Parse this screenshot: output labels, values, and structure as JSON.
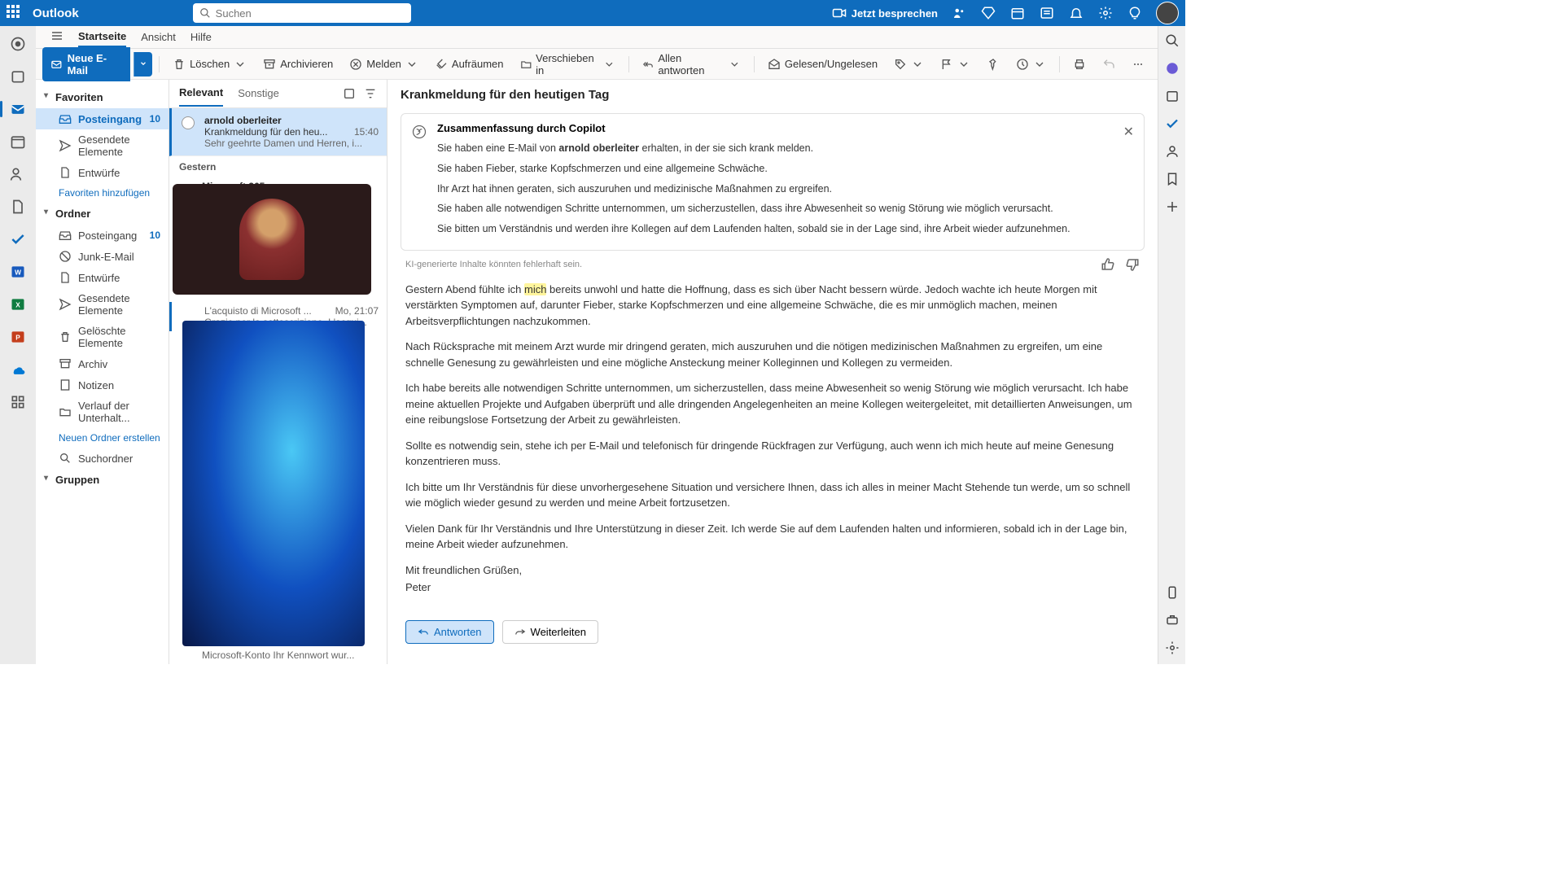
{
  "header": {
    "brand": "Outlook",
    "search_placeholder": "Suchen",
    "meet_label": "Jetzt besprechen"
  },
  "tabs": {
    "home": "Startseite",
    "view": "Ansicht",
    "help": "Hilfe"
  },
  "toolbar": {
    "new_mail": "Neue E-Mail",
    "delete": "Löschen",
    "archive": "Archivieren",
    "report": "Melden",
    "sweep": "Aufräumen",
    "moveto": "Verschieben in",
    "replyall": "Allen antworten",
    "readunread": "Gelesen/Ungelesen"
  },
  "folders": {
    "favorites": "Favoriten",
    "inbox": "Posteingang",
    "inbox_count": "10",
    "sent": "Gesendete Elemente",
    "drafts": "Entwürfe",
    "add_fav": "Favoriten hinzufügen",
    "section_folders": "Ordner",
    "junk": "Junk-E-Mail",
    "deleted": "Gelöschte Elemente",
    "archive": "Archiv",
    "notes": "Notizen",
    "history": "Verlauf der Unterhalt...",
    "new_folder": "Neuen Ordner erstellen",
    "search_folders": "Suchordner",
    "groups": "Gruppen"
  },
  "msglist": {
    "tab_focused": "Relevant",
    "tab_other": "Sonstige",
    "item1_from": "arnold oberleiter",
    "item1_subj": "Krankmeldung für den heu...",
    "item1_time": "15:40",
    "item1_prev": "Sehr geehrte Damen und Herren, i...",
    "day_yesterday": "Gestern",
    "item2_from": "Microsoft 365",
    "item3_subj": "L'acquisto di Microsoft ...",
    "item3_time": "Mo, 21:07",
    "item3_prev": "Grazie per la sottoscrizione. L'acqui...",
    "item4_prev": "Microsoft-Konto Ihr Kennwort wur..."
  },
  "reading": {
    "subject": "Krankmeldung für den heutigen Tag",
    "copilot_title": "Zusammenfassung durch Copilot",
    "summary_intro_a": "Sie haben eine E-Mail von ",
    "summary_sender": "arnold oberleiter",
    "summary_intro_b": " erhalten, in der sie sich krank melden.",
    "summary_2": "Sie haben Fieber, starke Kopfschmerzen und eine allgemeine Schwäche.",
    "summary_3": "Ihr Arzt hat ihnen geraten, sich auszuruhen und medizinische Maßnahmen zu ergreifen.",
    "summary_4": "Sie haben alle notwendigen Schritte unternommen, um sicherzustellen, dass ihre Abwesenheit so wenig Störung wie möglich verursacht.",
    "summary_5": "Sie bitten um Verständnis und werden ihre Kollegen auf dem Laufenden halten, sobald sie in der Lage sind, ihre Arbeit wieder aufzunehmen.",
    "ai_disclaimer": "KI-generierte Inhalte könnten fehlerhaft sein.",
    "body_p1a": "Gestern Abend fühlte ich ",
    "body_hl": "mich",
    "body_p1b": " bereits unwohl und hatte die Hoffnung, dass es sich über Nacht bessern würde. Jedoch wachte ich heute Morgen mit verstärkten Symptomen auf, darunter Fieber, starke Kopfschmerzen und eine allgemeine Schwäche, die es mir unmöglich machen, meinen Arbeitsverpflichtungen nachzukommen.",
    "body_p2": "Nach Rücksprache mit meinem Arzt wurde mir dringend geraten, mich auszuruhen und die nötigen medizinischen Maßnahmen zu ergreifen, um eine schnelle Genesung zu gewährleisten und eine mögliche Ansteckung meiner Kolleginnen und Kollegen zu vermeiden.",
    "body_p3": "Ich habe bereits alle notwendigen Schritte unternommen, um sicherzustellen, dass meine Abwesenheit so wenig Störung wie möglich verursacht. Ich habe meine aktuellen Projekte und Aufgaben überprüft und alle dringenden Angelegenheiten an meine Kollegen weitergeleitet, mit detaillierten Anweisungen, um eine reibungslose Fortsetzung der Arbeit zu gewährleisten.",
    "body_p4": "Sollte es notwendig sein, stehe ich per E-Mail und telefonisch für dringende Rückfragen zur Verfügung, auch wenn ich mich heute auf meine Genesung konzentrieren muss.",
    "body_p5": "Ich bitte um Ihr Verständnis für diese unvorhergesehene Situation und versichere Ihnen, dass ich alles in meiner Macht Stehende tun werde, um so schnell wie möglich wieder gesund zu werden und meine Arbeit fortzusetzen.",
    "body_p6": "Vielen Dank für Ihr Verständnis und Ihre Unterstützung in dieser Zeit. Ich werde Sie auf dem Laufenden halten und informieren, sobald ich in der Lage bin, meine Arbeit wieder aufzunehmen.",
    "body_close": "Mit freundlichen Grüßen,",
    "body_sig": "Peter",
    "reply": "Antworten",
    "forward": "Weiterleiten"
  }
}
